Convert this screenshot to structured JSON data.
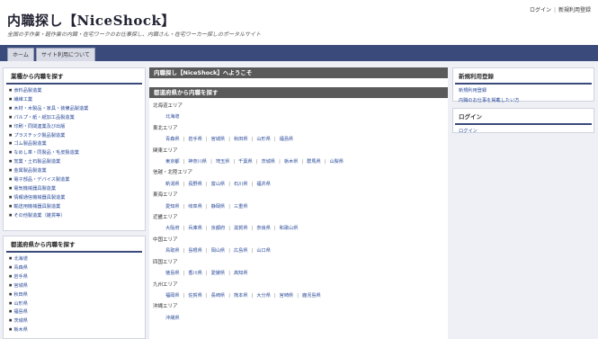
{
  "header": {
    "title": "内職探し【NiceShock】",
    "tagline": "全国の手作業・軽作業の内職・在宅ワークのお仕事探し、内職さん・在宅ワーカー探しのポータルサイト",
    "login": "ログイン",
    "register": "新規利用登録"
  },
  "nav": {
    "tabs": [
      "ホーム",
      "サイト利用について"
    ]
  },
  "sidebar": {
    "industry": {
      "title": "業種から内職を探す",
      "items": [
        "食料品製造業",
        "繊維工業",
        "木材・木製品・家具・装備品製造業",
        "パルプ・紙・紙加工品製造業",
        "印刷・同関連業及び出版",
        "プラスチック製品製造業",
        "ゴム製品製造業",
        "なめし革・同製品・毛皮製造業",
        "窯業・土石製品製造業",
        "金属製品製造業",
        "電子部品・デバイス製造業",
        "電気機械器具製造業",
        "情報通信機械器具製造業",
        "輸送用機械器具製造業",
        "その他製造業（雑貨等）"
      ]
    },
    "pref": {
      "title": "都道府県から内職を探す",
      "items": [
        "北海道",
        "青森県",
        "岩手県",
        "宮城県",
        "秋田県",
        "山形県",
        "福島県",
        "茨城県",
        "栃木県"
      ]
    }
  },
  "main": {
    "welcome": "内職探し【NiceShock】へようこそ",
    "pref_heading": "都道府県から内職を探す",
    "regions": [
      {
        "name": "北海道エリア",
        "prefs": [
          "北海道"
        ]
      },
      {
        "name": "東北エリア",
        "prefs": [
          "青森県",
          "岩手県",
          "宮城県",
          "秋田県",
          "山形県",
          "福島県"
        ]
      },
      {
        "name": "関東エリア",
        "prefs": [
          "東京都",
          "神奈川県",
          "埼玉県",
          "千葉県",
          "茨城県",
          "栃木県",
          "群馬県",
          "山梨県"
        ]
      },
      {
        "name": "信越・北陸エリア",
        "prefs": [
          "新潟県",
          "長野県",
          "富山県",
          "石川県",
          "福井県"
        ]
      },
      {
        "name": "東海エリア",
        "prefs": [
          "愛知県",
          "岐阜県",
          "静岡県",
          "三重県"
        ]
      },
      {
        "name": "近畿エリア",
        "prefs": [
          "大阪府",
          "兵庫県",
          "京都府",
          "滋賀県",
          "奈良県",
          "和歌山県"
        ]
      },
      {
        "name": "中国エリア",
        "prefs": [
          "鳥取県",
          "島根県",
          "岡山県",
          "広島県",
          "山口県"
        ]
      },
      {
        "name": "四国エリア",
        "prefs": [
          "徳島県",
          "香川県",
          "愛媛県",
          "高知県"
        ]
      },
      {
        "name": "九州エリア",
        "prefs": [
          "福岡県",
          "佐賀県",
          "長崎県",
          "熊本県",
          "大分県",
          "宮崎県",
          "鹿児島県"
        ]
      },
      {
        "name": "沖縄エリア",
        "prefs": [
          "沖縄県"
        ]
      }
    ]
  },
  "right": {
    "register": {
      "title": "新規利用登録",
      "links": [
        "新規利用登録",
        "内職のお仕事を掲載したい方"
      ]
    },
    "login": {
      "title": "ログイン",
      "links": [
        "ログイン"
      ]
    }
  }
}
